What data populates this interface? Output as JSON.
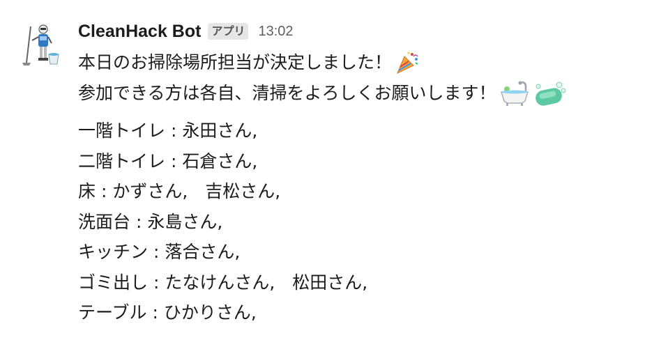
{
  "bot": {
    "name": "CleanHack Bot",
    "badge": "アプリ",
    "time": "13:02",
    "avatar_icon": "cleaning-robot-icon"
  },
  "message": {
    "line1": "本日のお掃除場所担当が決定しました！",
    "line1_emoji": "party-popper-icon",
    "line2": "参加できる方は各自、清掃をよろしくお願いします！",
    "line2_emojis": [
      "bathtub-icon",
      "soap-icon"
    ],
    "assignments": [
      "一階トイレ : 永田さん,",
      "二階トイレ : 石倉さん,",
      "床 : かずさん,　吉松さん,",
      "洗面台 : 永島さん,",
      "キッチン : 落合さん,",
      "ゴミ出し : たなけんさん,　松田さん,",
      "テーブル : ひかりさん,"
    ]
  }
}
